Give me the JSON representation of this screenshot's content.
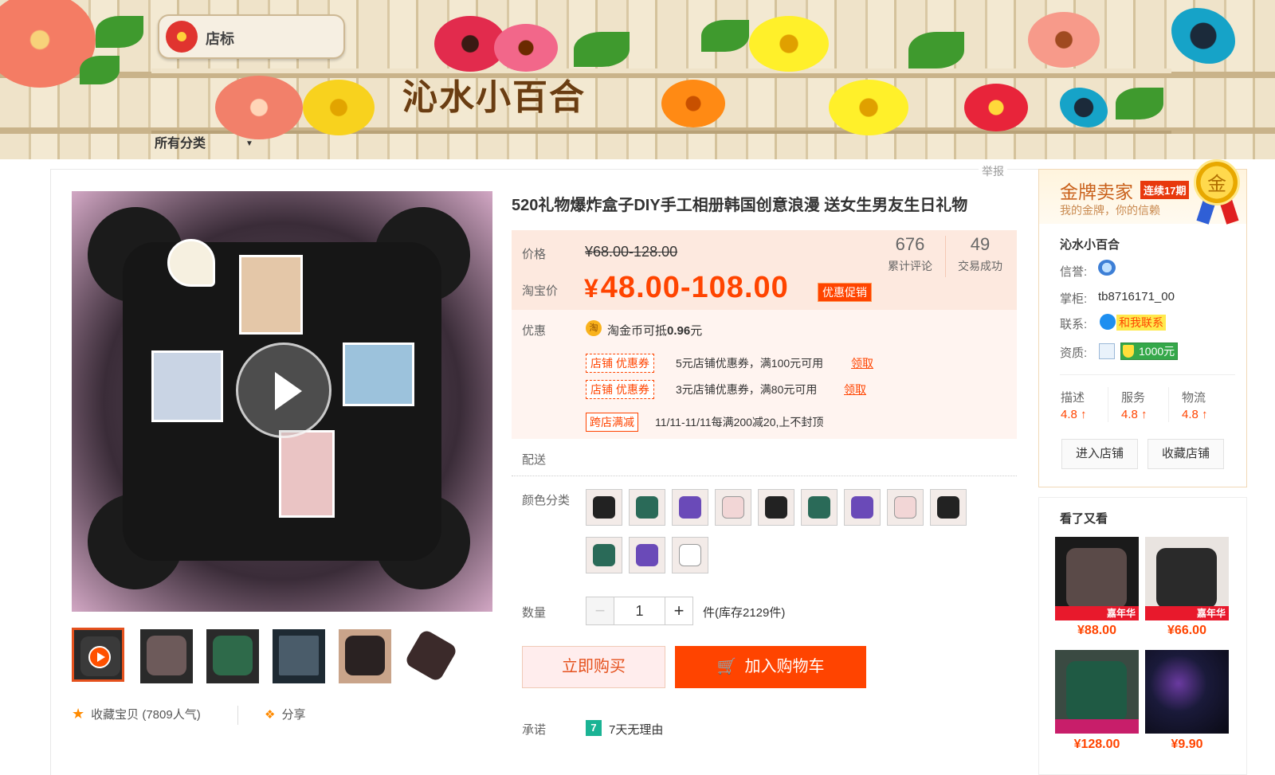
{
  "banner": {
    "store_badge_label": "店标",
    "shop_title": "沁水小百合",
    "all_categories": "所有分类"
  },
  "report_link": "举报",
  "gallery": {
    "thumbnails": [
      "video",
      "image-2",
      "image-3",
      "image-4",
      "image-5",
      "image-6"
    ],
    "favorite_label": "收藏宝贝",
    "favorite_count": "(7809人气)",
    "share_label": "分享"
  },
  "product": {
    "title": "520礼物爆炸盒子DIY手工相册韩国创意浪漫 送女生男友生日礼物",
    "price_label": "价格",
    "original_price": "¥68.00-128.00",
    "taobao_price_label": "淘宝价",
    "currency_symbol": "¥",
    "taobao_price": "48.00-108.00",
    "promo_tag": "优惠促销",
    "review_count": "676",
    "review_label": "累计评论",
    "sold_count": "49",
    "sold_label": "交易成功",
    "discount_label": "优惠",
    "coin_icon": "淘",
    "coin_text": "淘金币可抵",
    "coin_amount": "0.96",
    "coin_unit": "元",
    "coupons": [
      {
        "tag": "店铺 优惠券",
        "desc": "5元店铺优惠券，满100元可用",
        "link": "领取"
      },
      {
        "tag": "店铺 优惠券",
        "desc": "3元店铺优惠券，满80元可用",
        "link": "领取"
      }
    ],
    "cross_tag": "跨店满减",
    "cross_desc": "11/11-11/11每满200减20,上不封顶",
    "delivery_label": "配送",
    "color_label": "颜色分类",
    "quantity_label": "数量",
    "quantity_minus": "−",
    "quantity_value": "1",
    "quantity_plus": "+",
    "stock_text": "件(库存2129件)",
    "buy_now": "立即购买",
    "add_to_cart": "加入购物车",
    "promise_label": "承诺",
    "promise_icon": "7",
    "promise_text": "7天无理由"
  },
  "seller": {
    "gold_title": "金牌卖家",
    "gold_streak": "连续17期",
    "gold_subtitle": "我的金牌，你的信赖",
    "medal_char": "金",
    "shop_name": "沁水小百合",
    "credit_label": "信誉:",
    "owner_label": "掌柜:",
    "owner_value": "tb8716171_00",
    "contact_label": "联系:",
    "contact_button": "和我联系",
    "qualification_label": "资质:",
    "deposit": "1000元",
    "ratings": [
      {
        "label": "描述",
        "value": "4.8 ↑"
      },
      {
        "label": "服务",
        "value": "4.8 ↑"
      },
      {
        "label": "物流",
        "value": "4.8 ↑"
      }
    ],
    "enter_shop": "进入店铺",
    "favorite_shop": "收藏店铺"
  },
  "also_viewed": {
    "title": "看了又看",
    "items": [
      {
        "price": "¥88.00",
        "badge": "嘉年华"
      },
      {
        "price": "¥66.00",
        "badge": "嘉年华"
      },
      {
        "price": "¥128.00",
        "badge": ""
      },
      {
        "price": "¥9.90",
        "badge": ""
      }
    ]
  },
  "colors": {
    "accent": "#ff4400",
    "price": "#ff4400",
    "banner_title": "#6a3d12",
    "gold": "#c9601a"
  }
}
